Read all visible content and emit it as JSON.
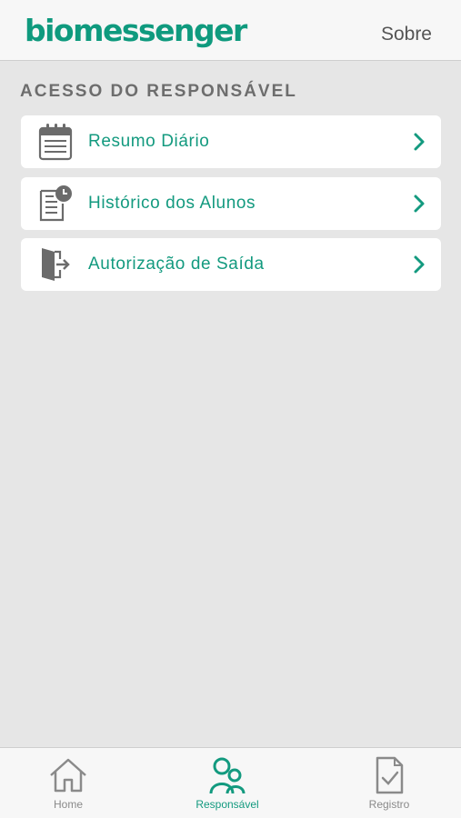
{
  "header": {
    "logo": "biomessenger",
    "about_label": "Sobre"
  },
  "section": {
    "title": "ACESSO DO RESPONSÁVEL"
  },
  "menu": {
    "items": [
      {
        "label": "Resumo Diário",
        "icon": "calendar-icon"
      },
      {
        "label": "Histórico dos Alunos",
        "icon": "document-clock-icon"
      },
      {
        "label": "Autorização de Saída",
        "icon": "exit-door-icon"
      }
    ]
  },
  "tabbar": {
    "tabs": [
      {
        "label": "Home",
        "icon": "home-icon",
        "active": false
      },
      {
        "label": "Responsável",
        "icon": "people-icon",
        "active": true
      },
      {
        "label": "Registro",
        "icon": "clipboard-check-icon",
        "active": false
      }
    ]
  },
  "colors": {
    "accent": "#139a7f",
    "background": "#e6e6e6",
    "header": "#f7f7f7",
    "icon_gray": "#6b6b6b"
  }
}
